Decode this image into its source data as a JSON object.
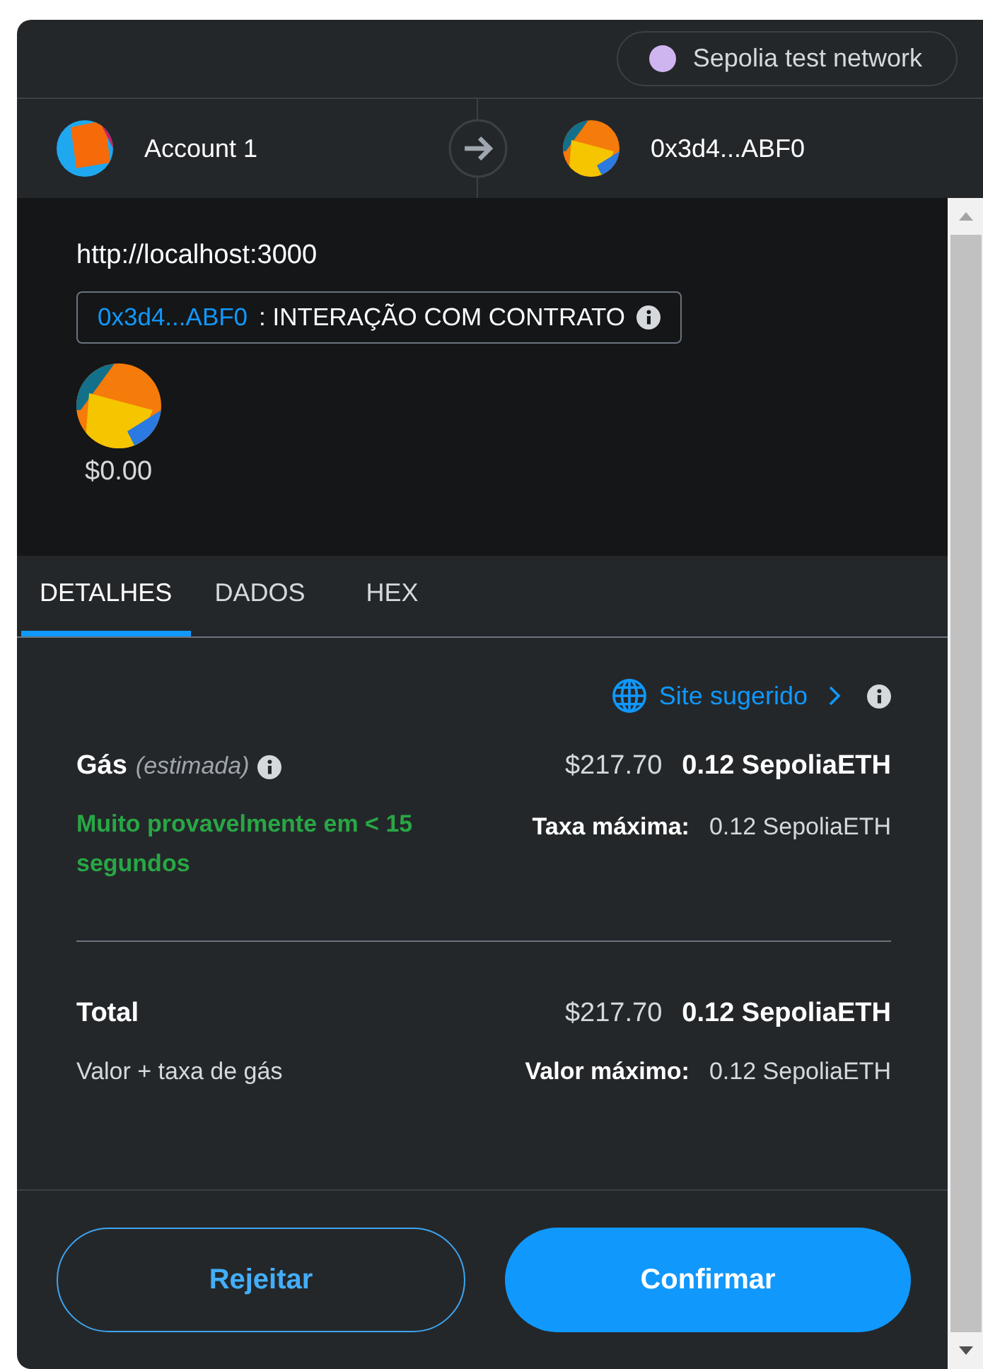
{
  "network": {
    "label": "Sepolia test network"
  },
  "sender": {
    "name": "Account 1"
  },
  "recipient": {
    "name": "0x3d4...ABF0"
  },
  "origin": "http://localhost:3000",
  "contract": {
    "address": "0x3d4...ABF0",
    "label": ": INTERAÇÃO COM CONTRATO"
  },
  "amount": "$0.00",
  "tabs": [
    {
      "label": "DETALHES",
      "selected": true
    },
    {
      "label": "DADOS",
      "selected": false
    },
    {
      "label": "HEX",
      "selected": false
    }
  ],
  "suggested_site": "Site sugerido",
  "gas": {
    "label": "Gás",
    "qualifier": "(estimada)",
    "fiat": "$217.70",
    "amount": "0.12 SepoliaETH",
    "timing": "Muito provavelmente em < 15 segundos",
    "max_label": "Taxa máxima:",
    "max_value": "0.12 SepoliaETH"
  },
  "total": {
    "label": "Total",
    "subtitle": "Valor + taxa de gás",
    "fiat": "$217.70",
    "amount": "0.12 SepoliaETH",
    "max_label": "Valor máximo:",
    "max_value": "0.12 SepoliaETH"
  },
  "buttons": [
    {
      "label": "Rejeitar",
      "kind": "secondary"
    },
    {
      "label": "Confirmar",
      "kind": "primary"
    }
  ]
}
